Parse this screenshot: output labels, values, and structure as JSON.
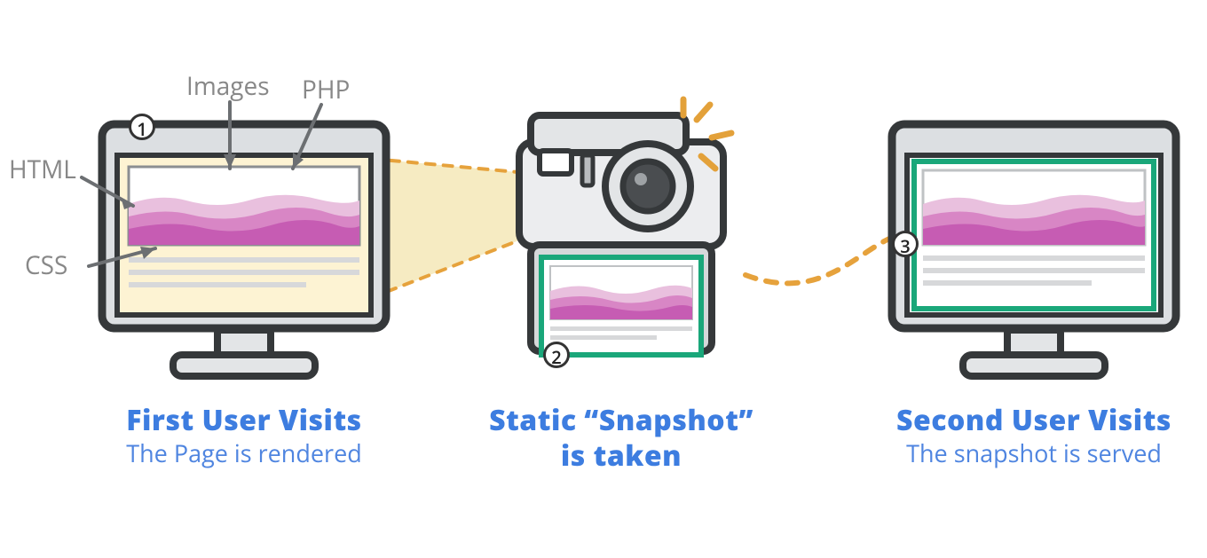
{
  "labels": {
    "html": "HTML",
    "images": "Images",
    "php": "PHP",
    "css": "CSS"
  },
  "badges": {
    "one": "1",
    "two": "2",
    "three": "3"
  },
  "captions": {
    "step1_title": "First User Visits",
    "step1_sub": "The Page is rendered",
    "step2_title_l1": "Static “Snapshot”",
    "step2_title_l2": "is taken",
    "step3_title": "Second User Visits",
    "step3_sub": "The snapshot is served"
  },
  "colors": {
    "accent_blue": "#3d7de0",
    "outline_dark": "#35383a",
    "screen_tint": "#fdf3d3",
    "snapshot_border": "#1aa77a",
    "connector": "#e6a23c",
    "wave_light": "#e9c0de",
    "wave_mid": "#d886c5",
    "wave_dark": "#c65cb3"
  }
}
